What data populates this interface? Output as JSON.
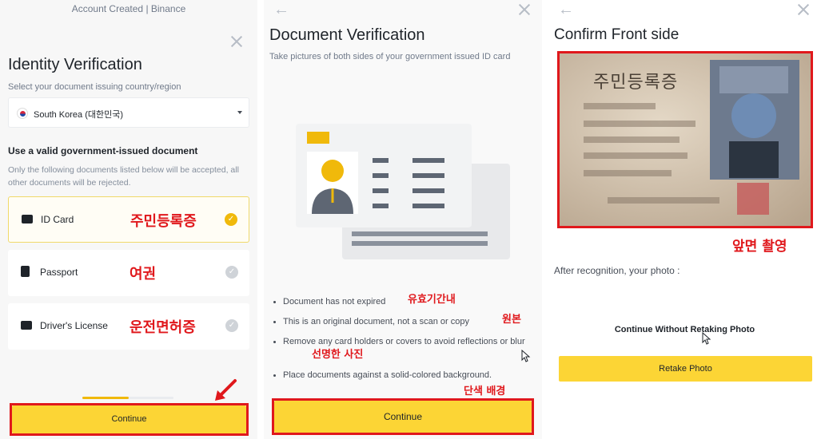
{
  "panel1": {
    "window_title": "Account Created | Binance",
    "title": "Identity Verification",
    "region_prompt": "Select your document issuing country/region",
    "country_value": "South Korea (대한민국)",
    "doc_heading": "Use a valid government-issued document",
    "doc_note": "Only the following documents listed below will be accepted, all other documents will be rejected.",
    "documents": [
      {
        "label": "ID Card",
        "annotation": "주민등록증",
        "selected": true,
        "icon": "id-card-icon"
      },
      {
        "label": "Passport",
        "annotation": "여권",
        "selected": false,
        "icon": "passport-icon"
      },
      {
        "label": "Driver's License",
        "annotation": "운전면허증",
        "selected": false,
        "icon": "license-icon"
      }
    ],
    "continue_label": "Continue"
  },
  "panel2": {
    "title": "Document Verification",
    "subtitle": "Take pictures of both sides of your government issued ID card",
    "bullets": [
      {
        "text": "Document has not expired",
        "annotation": "유효기간내"
      },
      {
        "text": "This is an original document, not a scan or copy",
        "annotation": "원본"
      },
      {
        "text": "Remove any card holders or covers to avoid reflections or blur",
        "annotation": "선명한 사진"
      },
      {
        "text": "Place documents against a solid-colored background.",
        "annotation": "단색 배경"
      }
    ],
    "continue_label": "Continue"
  },
  "panel3": {
    "title": "Confirm Front side",
    "id_card_heading": "주민등록증",
    "photo_annotation": "앞면 촬영",
    "after_text": "After recognition, your photo :",
    "continue_without_label": "Continue Without Retaking Photo",
    "retake_label": "Retake Photo"
  },
  "colors": {
    "accent": "#fcd535",
    "check_on": "#f0b90b",
    "annotation_red": "#e0181c"
  }
}
